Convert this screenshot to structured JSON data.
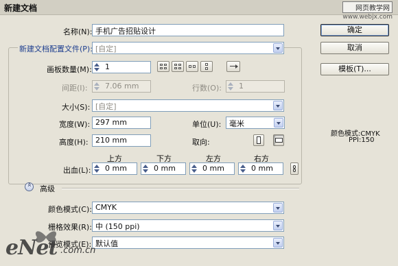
{
  "window": {
    "title": "新建文档"
  },
  "watermark": {
    "line1": "网页教学网",
    "line2": "www.webjx.com"
  },
  "form": {
    "name_label": "名称(N):",
    "name_value": "手机广告招贴设计",
    "profile_label": "新建文档配置文件(P):",
    "profile_value": "[自定]",
    "artboards_label": "画板数量(M):",
    "artboards_value": "1",
    "spacing_label": "间距(I):",
    "spacing_value": "7.06 mm",
    "rows_label": "行数(O):",
    "rows_value": "1",
    "size_label": "大小(S):",
    "size_value": "[自定]",
    "width_label": "宽度(W):",
    "width_value": "297 mm",
    "height_label": "高度(H):",
    "height_value": "210 mm",
    "units_label": "单位(U):",
    "units_value": "毫米",
    "orientation_label": "取向:",
    "bleed_label": "出血(L):",
    "bleed_headers": [
      "上方",
      "下方",
      "左方",
      "右方"
    ],
    "bleed_values": [
      "0 mm",
      "0 mm",
      "0 mm",
      "0 mm"
    ],
    "advanced_label": "高级",
    "color_mode_label": "颜色模式(C):",
    "color_mode_value": "CMYK",
    "raster_label": "栅格效果(R):",
    "raster_value": "中 (150 ppi)",
    "preview_label": "预览模式(E):",
    "preview_value": "默认值"
  },
  "buttons": {
    "ok": "确定",
    "cancel": "取消",
    "templates": "模板(T)..."
  },
  "info": {
    "color_mode": "颜色模式:CMYK",
    "ppi": "PPI:150"
  },
  "logo": {
    "text": "eNet",
    "suffix": ".com.cn"
  }
}
